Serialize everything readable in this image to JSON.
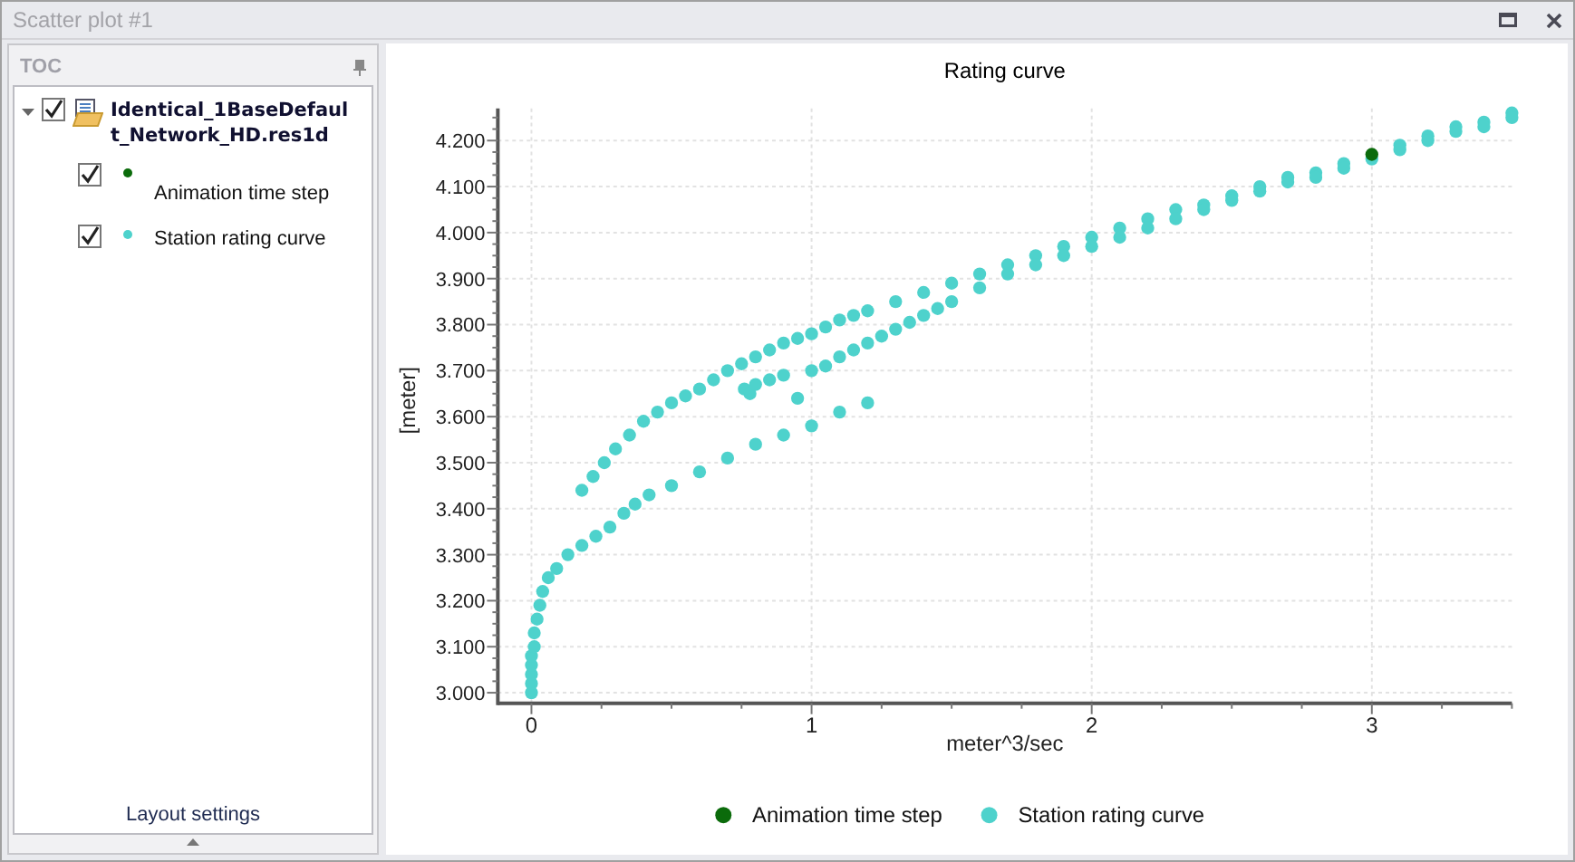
{
  "window": {
    "title": "Scatter plot #1"
  },
  "toc": {
    "title": "TOC",
    "footer": "Layout settings",
    "tree": [
      {
        "label": "Identical_1BaseDefault_Network_HD.res1d",
        "checked": true,
        "expanded": true,
        "children": [
          {
            "label": "Animation time step",
            "checked": true,
            "color": "#0b6b0b"
          },
          {
            "label": "Station rating curve",
            "checked": true,
            "color": "#4ed2cc"
          }
        ]
      }
    ]
  },
  "chart": {
    "chart_data": {
      "type": "scatter",
      "title": "Rating curve",
      "xlabel": "meter^3/sec",
      "ylabel": "[meter]",
      "xlim": [
        -0.12,
        3.5
      ],
      "ylim": [
        2977,
        4270
      ],
      "grid": true,
      "legend": "bottom",
      "xticks": [
        0,
        1,
        2,
        3
      ],
      "yticks": [
        {
          "value": 3000,
          "label": "3.000"
        },
        {
          "value": 3100,
          "label": "3.100"
        },
        {
          "value": 3200,
          "label": "3.200"
        },
        {
          "value": 3300,
          "label": "3.300"
        },
        {
          "value": 3400,
          "label": "3.400"
        },
        {
          "value": 3500,
          "label": "3.500"
        },
        {
          "value": 3600,
          "label": "3.600"
        },
        {
          "value": 3700,
          "label": "3.700"
        },
        {
          "value": 3800,
          "label": "3.800"
        },
        {
          "value": 3900,
          "label": "3.900"
        },
        {
          "value": 4000,
          "label": "4.000"
        },
        {
          "value": 4100,
          "label": "4.100"
        },
        {
          "value": 4200,
          "label": "4.200"
        }
      ],
      "series": [
        {
          "name": "Animation time step",
          "color": "#0b6b0b",
          "x": [
            3.0
          ],
          "values": [
            4170
          ]
        },
        {
          "name": "Station rating curve",
          "color": "#4ed2cc",
          "x": [
            0.18,
            0.22,
            0.26,
            0.3,
            0.35,
            0.4,
            0.45,
            0.5,
            0.55,
            0.6,
            0.65,
            0.7,
            0.75,
            0.8,
            0.85,
            0.9,
            0.95,
            1.0,
            1.05,
            1.1,
            1.15,
            1.2,
            1.3,
            1.4,
            1.5,
            1.6,
            1.7,
            1.8,
            1.9,
            2.0,
            2.1,
            2.2,
            2.3,
            2.4,
            2.5,
            2.6,
            2.7,
            2.8,
            2.9,
            3.1,
            3.2,
            3.3,
            3.4,
            3.5,
            0.0,
            0.0,
            0.0,
            0.0,
            0.0,
            0.01,
            0.01,
            0.02,
            0.03,
            0.04,
            0.06,
            0.09,
            0.13,
            0.18,
            0.23,
            0.28,
            0.33,
            0.37,
            0.42,
            0.5,
            0.6,
            0.7,
            0.8,
            0.9,
            1.0,
            1.1,
            1.2,
            0.76,
            0.78,
            0.8,
            0.85,
            0.9,
            0.95,
            1.0,
            1.05,
            1.1,
            1.15,
            1.2,
            1.25,
            1.3,
            1.35,
            1.4,
            1.45,
            1.5,
            1.6,
            1.7,
            1.8,
            1.9,
            2.0,
            2.1,
            2.2,
            2.3,
            2.4,
            2.5,
            2.6,
            2.7,
            2.8,
            2.9,
            3.0,
            3.1,
            3.2,
            3.3,
            3.4,
            3.5
          ],
          "values": [
            3440,
            3470,
            3500,
            3530,
            3560,
            3590,
            3610,
            3630,
            3645,
            3660,
            3680,
            3700,
            3715,
            3730,
            3745,
            3760,
            3770,
            3780,
            3795,
            3810,
            3820,
            3830,
            3850,
            3870,
            3890,
            3910,
            3930,
            3950,
            3970,
            3990,
            4010,
            4030,
            4050,
            4060,
            4080,
            4100,
            4120,
            4130,
            4150,
            4190,
            4210,
            4230,
            4240,
            4260,
            3000,
            3020,
            3040,
            3060,
            3080,
            3100,
            3130,
            3160,
            3190,
            3220,
            3250,
            3270,
            3300,
            3320,
            3340,
            3360,
            3390,
            3410,
            3430,
            3450,
            3480,
            3510,
            3540,
            3560,
            3580,
            3610,
            3630,
            3660,
            3650,
            3670,
            3680,
            3690,
            3640,
            3700,
            3710,
            3730,
            3745,
            3760,
            3775,
            3790,
            3805,
            3820,
            3835,
            3850,
            3880,
            3910,
            3930,
            3950,
            3970,
            3990,
            4010,
            4030,
            4050,
            4070,
            4090,
            4110,
            4120,
            4140,
            4160,
            4180,
            4200,
            4220,
            4230,
            4250
          ]
        }
      ]
    }
  }
}
